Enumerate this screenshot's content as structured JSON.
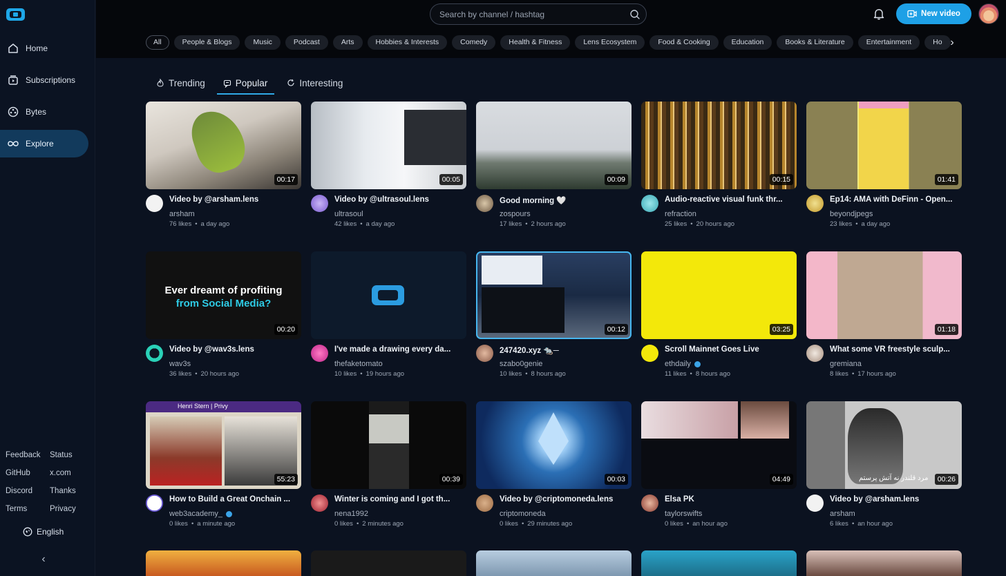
{
  "sidebar": {
    "nav": [
      {
        "label": "Home",
        "icon": "home-icon",
        "active": false
      },
      {
        "label": "Subscriptions",
        "icon": "subscriptions-icon",
        "active": false
      },
      {
        "label": "Bytes",
        "icon": "bytes-icon",
        "active": false
      },
      {
        "label": "Explore",
        "icon": "explore-icon",
        "active": true
      }
    ],
    "footer_links": [
      "Feedback",
      "Status",
      "GitHub",
      "x.com",
      "Discord",
      "Thanks",
      "Terms",
      "Privacy"
    ],
    "language": "English",
    "collapse_glyph": "‹"
  },
  "header": {
    "search_placeholder": "Search by channel / hashtag",
    "new_video_label": "New video"
  },
  "categories": [
    "All",
    "People & Blogs",
    "Music",
    "Podcast",
    "Arts",
    "Hobbies & Interests",
    "Comedy",
    "Health & Fitness",
    "Lens Ecosystem",
    "Food & Cooking",
    "Education",
    "Books & Literature",
    "Entertainment",
    "Ho"
  ],
  "tabs": [
    {
      "label": "Trending",
      "icon": "trending-icon",
      "active": false
    },
    {
      "label": "Popular",
      "icon": "popular-icon",
      "active": true
    },
    {
      "label": "Interesting",
      "icon": "interesting-icon",
      "active": false
    }
  ],
  "videos": [
    {
      "title": "Video by @arsham.lens",
      "channel": "arsham",
      "likes": "76 likes",
      "time": "a day ago",
      "duration": "00:17",
      "verified": false
    },
    {
      "title": "Video by @ultrasoul.lens",
      "channel": "ultrasoul",
      "likes": "42 likes",
      "time": "a day ago",
      "duration": "00:05",
      "verified": false
    },
    {
      "title": "Good morning 🤍",
      "channel": "zospours",
      "likes": "17 likes",
      "time": "2 hours ago",
      "duration": "00:09",
      "verified": false
    },
    {
      "title": "Audio-reactive visual funk thr...",
      "channel": "refraction",
      "likes": "25 likes",
      "time": "20 hours ago",
      "duration": "00:15",
      "verified": false
    },
    {
      "title": "Ep14: AMA with DeFinn - Open...",
      "channel": "beyondjpegs",
      "likes": "23 likes",
      "time": "a day ago",
      "duration": "01:41",
      "verified": false
    },
    {
      "title": "Video by @wav3s.lens",
      "channel": "wav3s",
      "likes": "36 likes",
      "time": "20 hours ago",
      "duration": "00:20",
      "verified": false,
      "thumb_line1": "Ever dreamt of profiting",
      "thumb_line2": "from Social Media?"
    },
    {
      "title": "I've made a drawing every da...",
      "channel": "thefaketomato",
      "likes": "10 likes",
      "time": "19 hours ago",
      "duration": "",
      "verified": false
    },
    {
      "title": "247420.xyz 🐀─",
      "channel": "szabo0genie",
      "likes": "10 likes",
      "time": "8 hours ago",
      "duration": "00:12",
      "verified": false
    },
    {
      "title": "Scroll Mainnet Goes Live",
      "channel": "ethdaily",
      "likes": "11 likes",
      "time": "8 hours ago",
      "duration": "03:25",
      "verified": true
    },
    {
      "title": "What some VR freestyle sculp...",
      "channel": "gremiana",
      "likes": "8 likes",
      "time": "17 hours ago",
      "duration": "01:18",
      "verified": false
    },
    {
      "title": "How to Build a Great Onchain ...",
      "channel": "web3academy_",
      "likes": "0 likes",
      "time": "a minute ago",
      "duration": "55:23",
      "verified": true,
      "thumb_header": "Henri Stern | Privy"
    },
    {
      "title": "Winter is coming and I got th...",
      "channel": "nena1992",
      "likes": "0 likes",
      "time": "2 minutes ago",
      "duration": "00:39",
      "verified": false
    },
    {
      "title": "Video by @criptomoneda.lens",
      "channel": "criptomoneda",
      "likes": "0 likes",
      "time": "29 minutes ago",
      "duration": "00:03",
      "verified": false
    },
    {
      "title": "Elsa PK",
      "channel": "taylorswifts",
      "likes": "0 likes",
      "time": "an hour ago",
      "duration": "04:49",
      "verified": false
    },
    {
      "title": "Video by @arsham.lens",
      "channel": "arsham",
      "likes": "6 likes",
      "time": "an hour ago",
      "duration": "00:26",
      "verified": false,
      "thumb_caption": "مرد قلندر نه آتش پرستم"
    }
  ],
  "colors": {
    "accent": "#1ea0e6",
    "active_nav": "#123a5c",
    "background": "#0b1220"
  }
}
